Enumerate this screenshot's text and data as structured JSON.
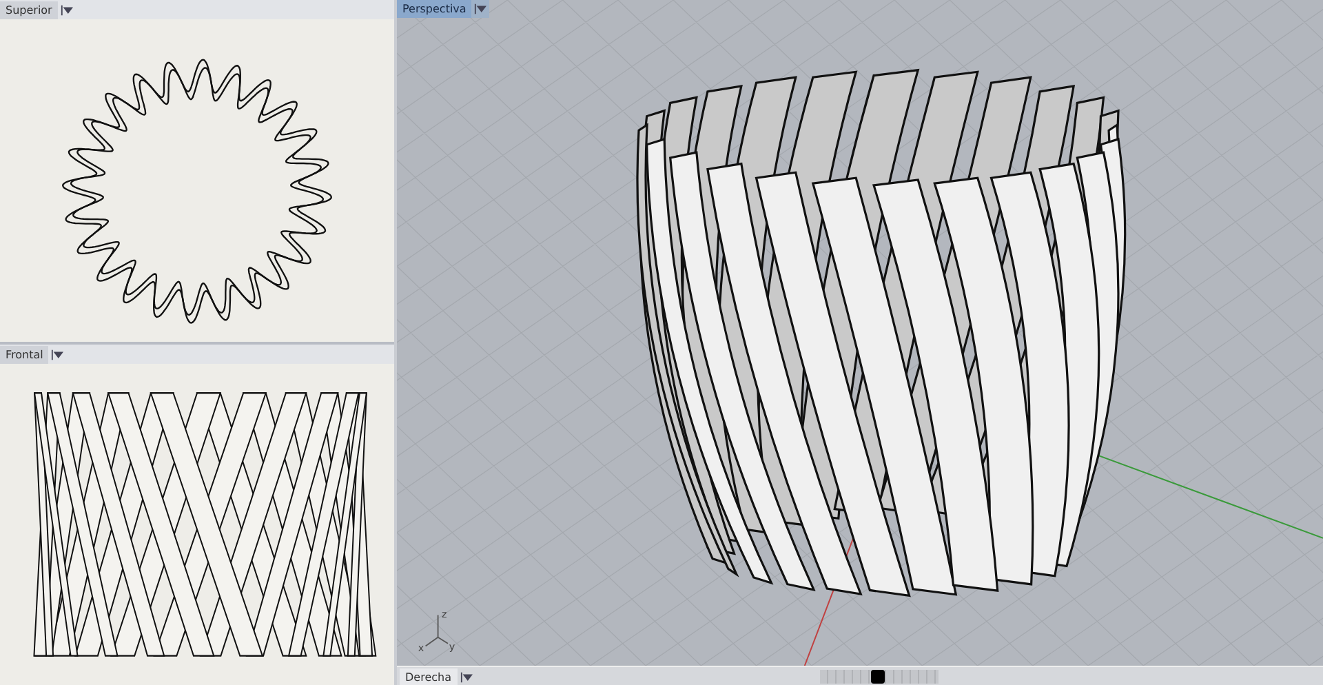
{
  "viewports": [
    {
      "title": "Superior",
      "selected": false,
      "kind": "top"
    },
    {
      "title": "Frontal",
      "selected": false,
      "kind": "front"
    },
    {
      "title": "Perspectiva",
      "selected": true,
      "kind": "perspective",
      "axis_labels": [
        "z",
        "x",
        "y"
      ]
    }
  ],
  "bottom_tabs": [
    {
      "label": "Derecha",
      "selected": false
    }
  ]
}
